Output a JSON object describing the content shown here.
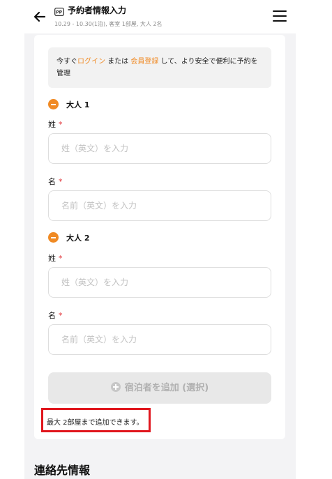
{
  "header": {
    "title": "予約者情報入力",
    "subtitle": "10.29 - 10.30(1泊), 客室 1部屋, 大人 2名",
    "back_icon": "arrow-left-icon",
    "menu_icon": "hamburger-menu-icon",
    "title_icon": "passport-icon"
  },
  "notice": {
    "prefix": "今すぐ",
    "login": "ログイン",
    "middle": " または ",
    "register": "会員登録",
    "suffix": " して、より安全で便利に予約を管理"
  },
  "adults": [
    {
      "label": "大人 1",
      "last_name_label": "姓",
      "last_name_placeholder": "姓（英文）を入力",
      "first_name_label": "名",
      "first_name_placeholder": "名前（英文）を入力"
    },
    {
      "label": "大人 2",
      "last_name_label": "姓",
      "last_name_placeholder": "姓（英文）を入力",
      "first_name_label": "名",
      "first_name_placeholder": "名前（英文）を入力"
    }
  ],
  "required_mark": "*",
  "add_guest_button": "宿泊者を追加 (選択)",
  "max_note": "最大 2部屋まで追加できます。",
  "contact_section_title": "連絡先情報",
  "colors": {
    "accent": "#f08a24",
    "required": "#e0363a",
    "highlight": "#e0161d"
  }
}
